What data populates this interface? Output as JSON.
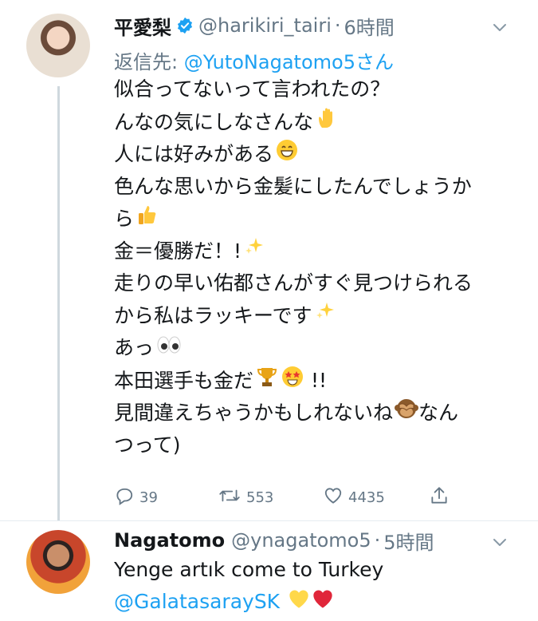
{
  "tweet1": {
    "name": "平愛梨",
    "handle": "@harikiri_tairi",
    "dot": "·",
    "time": "6時間",
    "reply_prefix": "返信先: ",
    "reply_mention": "@YutoNagatomo5さん",
    "lines": [
      "似合ってないって言われたの？",
      "んなの気にしなさんな",
      "人には好みがある",
      "色んな思いから金髪にしたんでしょうか",
      "ら",
      "金＝優勝だ！!",
      "走りの早い佑都さんがすぐ見つけられる",
      "から私はラッキーです",
      "あっ",
      "本田選手も金だ",
      "見間違えちゃうかもしれないね",
      "つって)"
    ],
    "line10_suffix": "!!",
    "line11_suffix": "なん",
    "emojis": {
      "line2": "raised-hand-emoji",
      "line3": "grinning-face-emoji",
      "line5": "thumbs-up-emoji",
      "line6": "sparkles-emoji",
      "line8": "sparkles-emoji",
      "line9": "eyes-emoji",
      "line10a": "trophy-emoji",
      "line10b": "star-struck-emoji",
      "line11": "see-no-evil-monkey-emoji"
    },
    "reply_count": "39",
    "retweet_count": "553",
    "like_count": "4435"
  },
  "tweet2": {
    "name": "Nagatomo",
    "handle": "@ynagatomo5",
    "dot": "·",
    "time": "5時間",
    "line1": "Yenge artık come to Turkey",
    "mention": "@GalatasaraySK",
    "emojis": [
      "yellow-heart-emoji",
      "red-heart-emoji"
    ]
  },
  "colors": {
    "link": "#1da1f2",
    "secondary": "#657786",
    "text": "#14171a",
    "divider": "#e6ecf0"
  }
}
